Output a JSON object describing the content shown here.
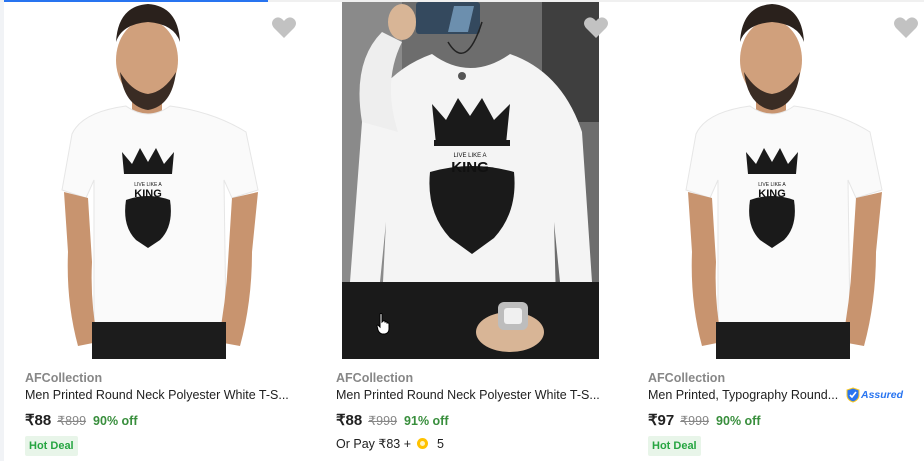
{
  "products": [
    {
      "brand": "AFCollection",
      "title": "Men Printed Round Neck Polyester White T-S...",
      "price": "₹88",
      "mrp": "₹899",
      "discount": "90% off",
      "badge": "Hot Deal",
      "image_print_line1": "LIVE LIKE A",
      "image_print_line2": "KING",
      "wishlist_icon": "heart-icon"
    },
    {
      "brand": "AFCollection",
      "title": "Men Printed Round Neck Polyester White T-S...",
      "price": "₹88",
      "mrp": "₹999",
      "discount": "91% off",
      "or_pay_prefix": "Or Pay ₹83 +",
      "coins": "5",
      "image_print_line1": "LIVE LIKE A",
      "image_print_line2": "KING",
      "wishlist_icon": "heart-icon"
    },
    {
      "brand": "AFCollection",
      "title": "Men Printed, Typography Round...",
      "price": "₹97",
      "mrp": "₹999",
      "discount": "90% off",
      "badge": "Hot Deal",
      "assured_label": "Assured",
      "image_print_line1": "LIVE LIKE A",
      "image_print_line2": "KING",
      "wishlist_icon": "heart-icon"
    }
  ],
  "colors": {
    "accent": "#2874f0",
    "discount": "#388e3c",
    "badge_bg": "#e8f5e9",
    "badge_text": "#26a541",
    "muted": "#878787",
    "heart": "#c2c2c2"
  }
}
